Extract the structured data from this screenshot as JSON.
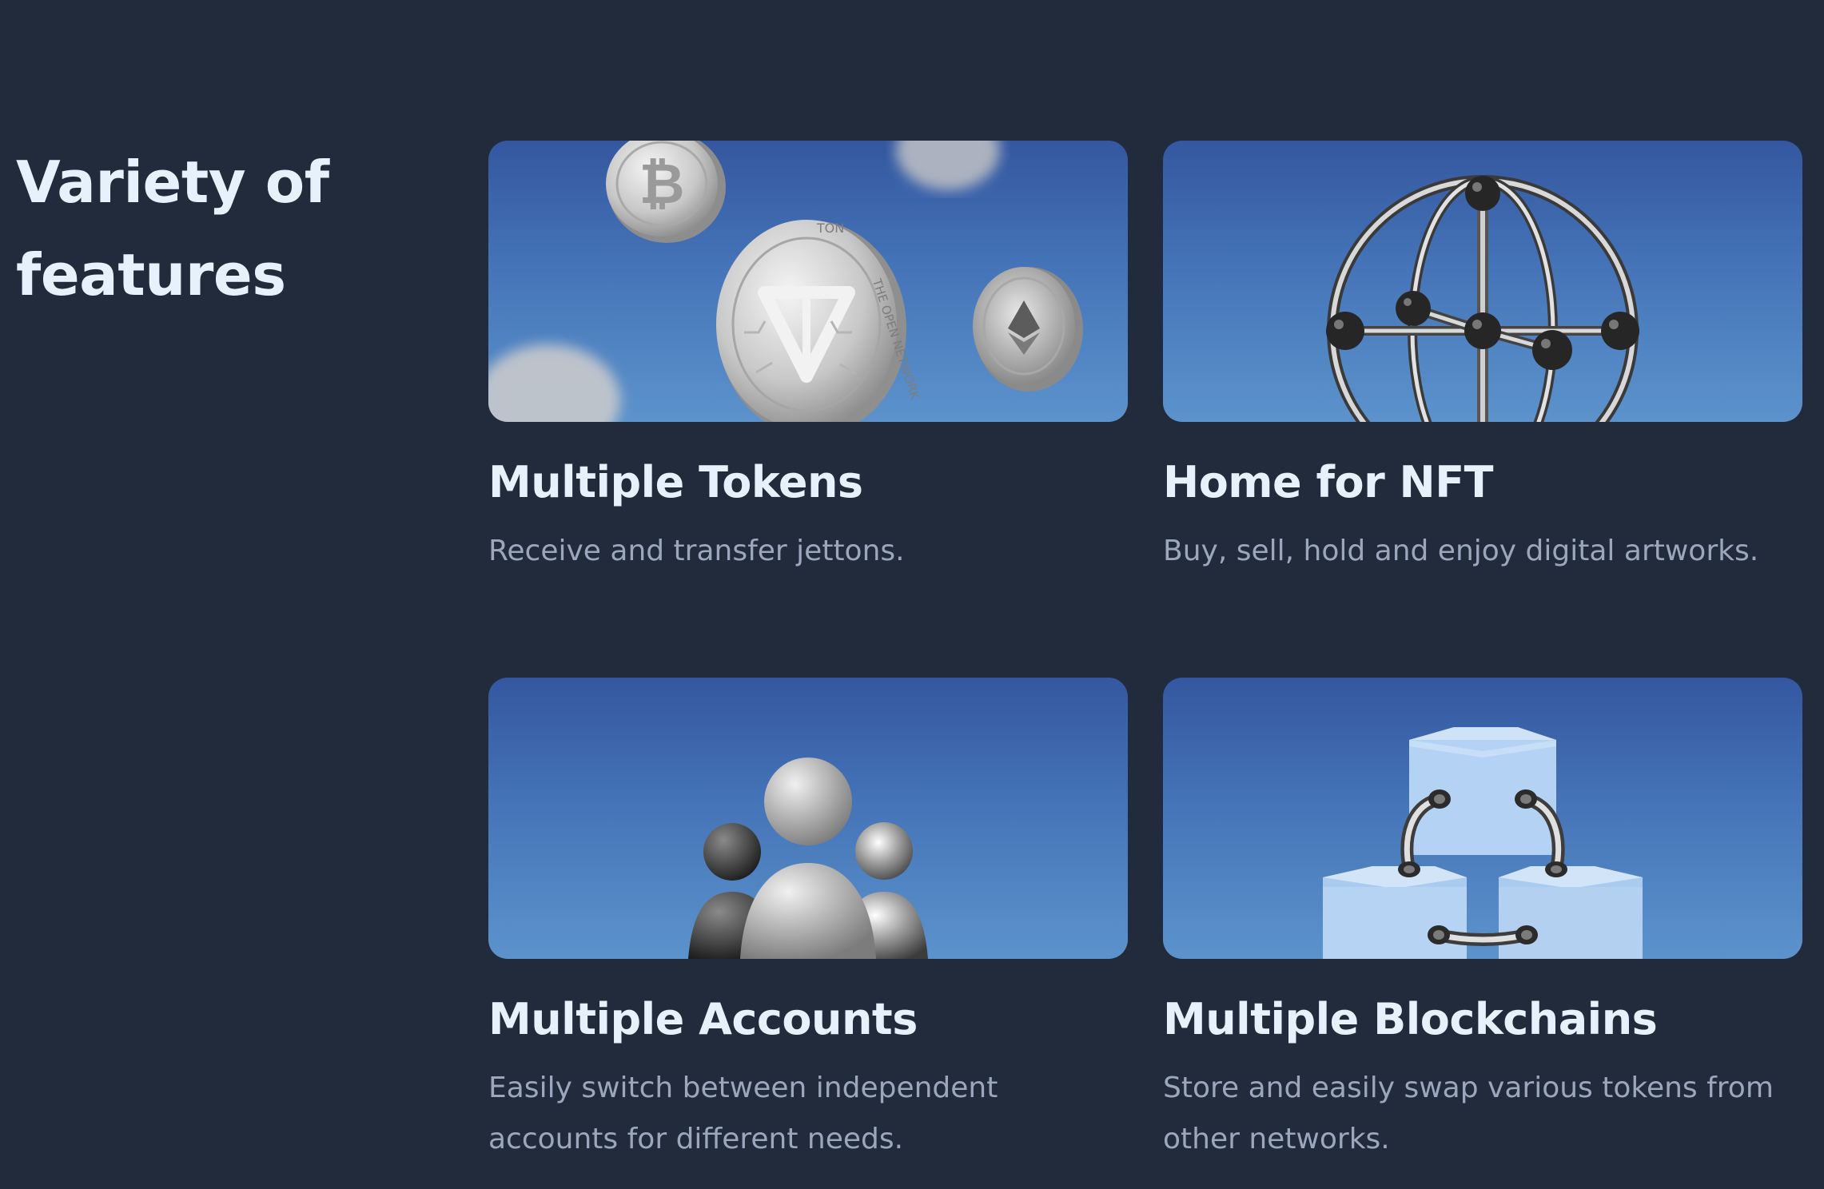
{
  "section": {
    "title": "Variety of features"
  },
  "cards": [
    {
      "title": "Multiple Tokens",
      "description": "Receive and transfer jettons.",
      "icon": "coins-illustration"
    },
    {
      "title": "Home for NFT",
      "description": "Buy, sell, hold and enjoy digital artworks.",
      "icon": "globe-wireframe-illustration"
    },
    {
      "title": "Multiple Accounts",
      "description": "Easily switch between independent accounts for different needs.",
      "icon": "people-illustration"
    },
    {
      "title": "Multiple Blockchains",
      "description": "Store and easily swap various tokens from other networks.",
      "icon": "linked-blocks-illustration"
    }
  ],
  "coin_labels": {
    "ton_top": "TON",
    "ton_ring": "THE OPEN NETWORK"
  },
  "colors": {
    "background": "#222b3b",
    "heading": "#e6f1fb",
    "description": "#9aa7bd",
    "card_gradient_top": "#3457a0",
    "card_gradient_bottom": "#5c93cc"
  }
}
